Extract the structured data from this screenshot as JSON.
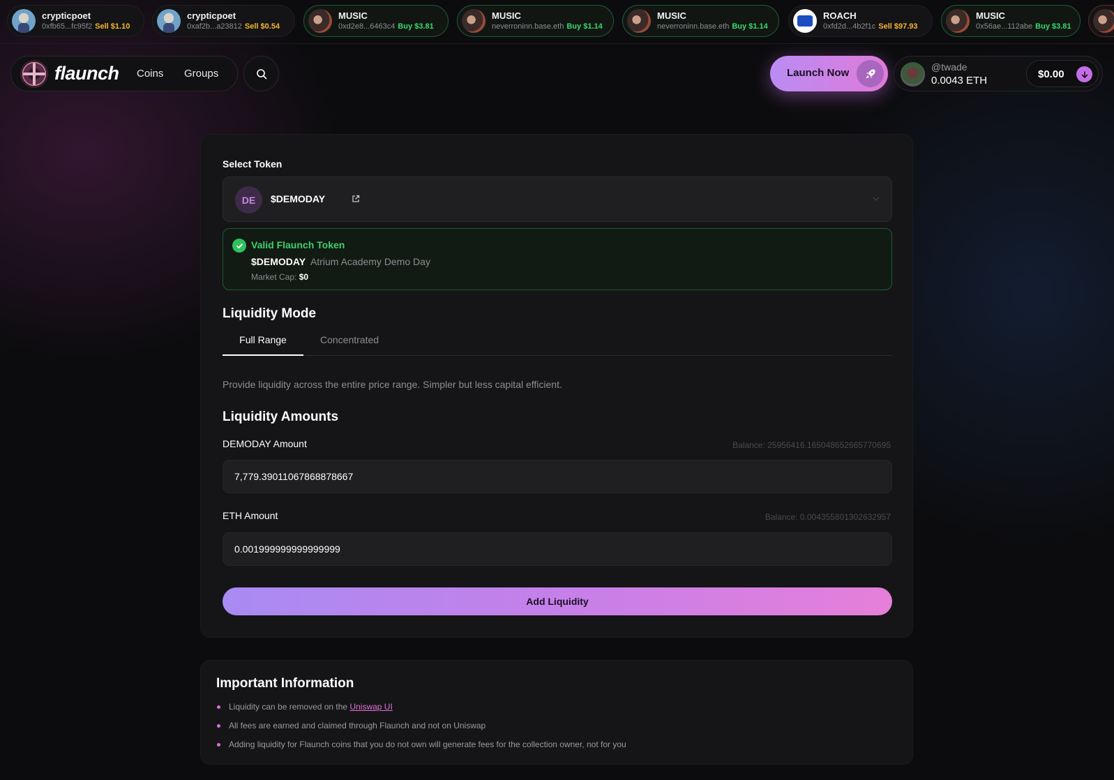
{
  "ticker": [
    {
      "name": "crypticpoet",
      "address": "0xfb65...fc95f2",
      "action": "Sell $1.10",
      "kind": "sell",
      "avatar": "poet"
    },
    {
      "name": "crypticpoet",
      "address": "0xaf2b...a23812",
      "action": "Sell $0.54",
      "kind": "sell",
      "avatar": "poet"
    },
    {
      "name": "MUSIC",
      "address": "0xd2e8...6463c4",
      "action": "Buy $3.81",
      "kind": "buy",
      "avatar": "music"
    },
    {
      "name": "MUSIC",
      "address": "neverroninn.base.eth",
      "action": "Buy $1.14",
      "kind": "buy",
      "avatar": "music"
    },
    {
      "name": "MUSIC",
      "address": "neverroninn.base.eth",
      "action": "Buy $1.14",
      "kind": "buy",
      "avatar": "music"
    },
    {
      "name": "ROACH",
      "address": "0xfd2d...4b2f1c",
      "action": "Sell $97.93",
      "kind": "sell",
      "avatar": "roach"
    },
    {
      "name": "MUSIC",
      "address": "0x56ae...112abe",
      "action": "Buy $3.81",
      "kind": "buy",
      "avatar": "music"
    }
  ],
  "header": {
    "logo_text": "flaunch",
    "nav": [
      "Coins",
      "Groups"
    ],
    "launch_label": "Launch Now",
    "wallet_user": "@twade",
    "wallet_eth": "0.0043 ETH",
    "wallet_balance": "$0.00"
  },
  "token": {
    "section_label": "Select Token",
    "avatar_initials": "DE",
    "symbol": "$DEMODAY",
    "valid_title": "Valid Flaunch Token",
    "valid_symbol": "$DEMODAY",
    "valid_name": "Atrium Academy Demo Day",
    "market_cap_label": "Market Cap:",
    "market_cap_value": "$0"
  },
  "mode": {
    "title": "Liquidity Mode",
    "tabs": [
      "Full Range",
      "Concentrated"
    ],
    "active_tab": "Full Range",
    "description": "Provide liquidity across the entire price range. Simpler but less capital efficient."
  },
  "amounts": {
    "title": "Liquidity Amounts",
    "token_label": "DEMODAY Amount",
    "token_balance": "Balance: 25956416.165048652665770695",
    "token_value": "7,779.39011067868878667",
    "eth_label": "ETH Amount",
    "eth_balance": "Balance: 0.004355801302632957",
    "eth_value": "0.001999999999999999",
    "submit_label": "Add Liquidity"
  },
  "info": {
    "title": "Important Information",
    "item1_prefix": "Liquidity can be removed on the ",
    "item1_link": "Uniswap UI",
    "item2": "All fees are earned and claimed through Flaunch and not on Uniswap",
    "item3": "Adding liquidity for Flaunch coins that you do not own will generate fees for the collection owner, not for you"
  },
  "colors": {
    "accent_gradient_start": "#a88bf2",
    "accent_gradient_end": "#e67fd9",
    "buy": "#39d96a",
    "sell": "#f5b731",
    "valid": "#3ed16c",
    "background": "#0c0c0e"
  }
}
